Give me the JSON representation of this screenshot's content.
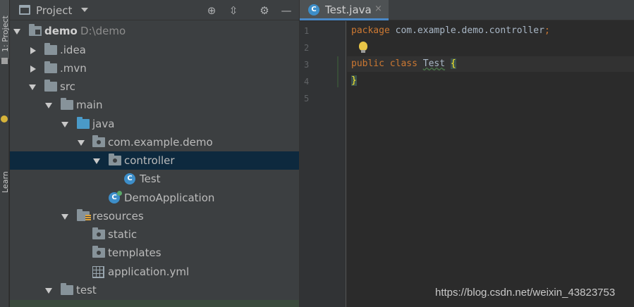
{
  "left_strip": {
    "project_tab": "1: Project",
    "learn_tab": "Learn"
  },
  "project_panel": {
    "title": "Project",
    "buttons": [
      "locate-icon",
      "collapse-icon",
      "gear-icon",
      "minimize-icon"
    ],
    "tree": [
      {
        "label": "demo",
        "extra": "D:\\demo",
        "icon": "project-folder",
        "expanded": true
      },
      {
        "label": ".idea",
        "icon": "folder",
        "expanded": false
      },
      {
        "label": ".mvn",
        "icon": "folder",
        "expanded": false
      },
      {
        "label": "src",
        "icon": "folder",
        "expanded": true
      },
      {
        "label": "main",
        "icon": "folder",
        "expanded": true
      },
      {
        "label": "java",
        "icon": "source-folder",
        "expanded": true
      },
      {
        "label": "com.example.demo",
        "icon": "package",
        "expanded": true
      },
      {
        "label": "controller",
        "icon": "package",
        "expanded": true,
        "selected": true
      },
      {
        "label": "Test",
        "icon": "class"
      },
      {
        "label": "DemoApplication",
        "icon": "runnable-class"
      },
      {
        "label": "resources",
        "icon": "resources-folder",
        "expanded": true
      },
      {
        "label": "static",
        "icon": "package"
      },
      {
        "label": "templates",
        "icon": "package"
      },
      {
        "label": "application.yml",
        "icon": "yml-file"
      },
      {
        "label": "test",
        "icon": "folder",
        "expanded": true
      }
    ]
  },
  "editor": {
    "tab": {
      "label": "Test.java",
      "close": "×",
      "icon_letter": "C"
    },
    "line_numbers": [
      "1",
      "2",
      "3",
      "4",
      "5"
    ],
    "lines": [
      {
        "kw": "package",
        "rest": " com.example.demo.controller",
        "tail": ";"
      },
      {},
      {
        "kw": "public class",
        "name": "Test",
        "brace": "{"
      },
      {
        "brace": "}"
      },
      {}
    ]
  },
  "watermark": "https://blog.csdn.net/weixin_43823753",
  "colors": {
    "panel_bg": "#3c3f41",
    "editor_bg": "#2b2b2b",
    "selection": "#0d293e",
    "keyword": "#cc7832",
    "accent": "#4a88c7"
  }
}
